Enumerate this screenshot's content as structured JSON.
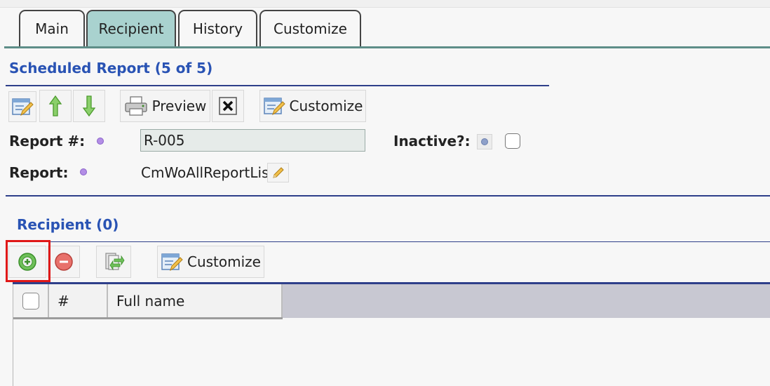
{
  "tabs": [
    {
      "label": "Main",
      "active": false
    },
    {
      "label": "Recipient",
      "active": true
    },
    {
      "label": "History",
      "active": false
    },
    {
      "label": "Customize",
      "active": false
    }
  ],
  "scheduled_report": {
    "title": "Scheduled Report (5 of 5)",
    "toolbar": {
      "preview_label": "Preview",
      "customize_label": "Customize"
    },
    "fields": {
      "report_num_label": "Report #:",
      "report_num_value": "R-005",
      "inactive_label": "Inactive?:",
      "inactive_checked": false,
      "report_label": "Report:",
      "report_value": "CmWoAllReportList"
    }
  },
  "recipient": {
    "title": "Recipient (0)",
    "toolbar": {
      "customize_label": "Customize"
    },
    "grid": {
      "columns": [
        "#",
        "Full name"
      ],
      "rows": []
    }
  },
  "colors": {
    "accent_title": "#2953b4",
    "active_tab": "#a9d2cf",
    "highlight_box": "#e01818"
  }
}
